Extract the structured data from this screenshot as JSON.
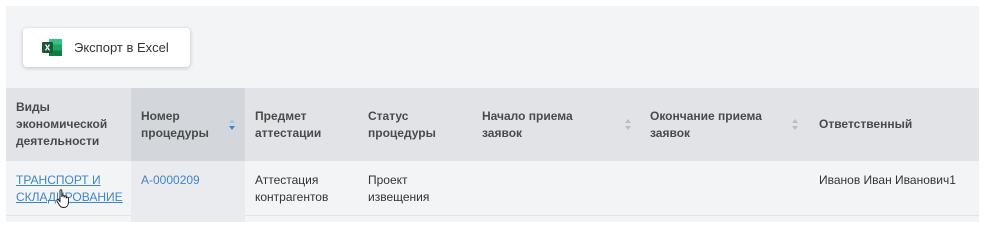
{
  "toolbar": {
    "export_label": "Экспорт в Excel",
    "export_icon": "excel-icon",
    "excel_color": "#1e7145"
  },
  "table": {
    "columns": [
      {
        "label": "Виды\nэкономической\nдеятельности",
        "sortable": false
      },
      {
        "label": "Номер\nпроцедуры",
        "sortable": true,
        "sorted": "desc"
      },
      {
        "label": "Предмет\nаттестации",
        "sortable": false
      },
      {
        "label": "Статус\nпроцедуры",
        "sortable": false
      },
      {
        "label": "Начало приема\nзаявок",
        "sortable": true
      },
      {
        "label": "Окончание приема\nзаявок",
        "sortable": true
      },
      {
        "label": "Ответственный",
        "sortable": false
      }
    ],
    "rows": [
      {
        "activity": "ТРАНСПОРТ И\nСКЛАДИРОВАНИЕ",
        "number": "А-0000209",
        "subject": "Аттестация\nконтрагентов",
        "status": "Проект\nизвещения",
        "start": "",
        "end": "",
        "responsible": "Иванов Иван Иванович1"
      }
    ]
  },
  "colors": {
    "link": "#3f86c8",
    "header_bg": "#e1e3e7",
    "sorted_header_bg": "#d3d6db",
    "sort_active": "#3f86c8",
    "sort_inactive": "#b9bcc2"
  }
}
